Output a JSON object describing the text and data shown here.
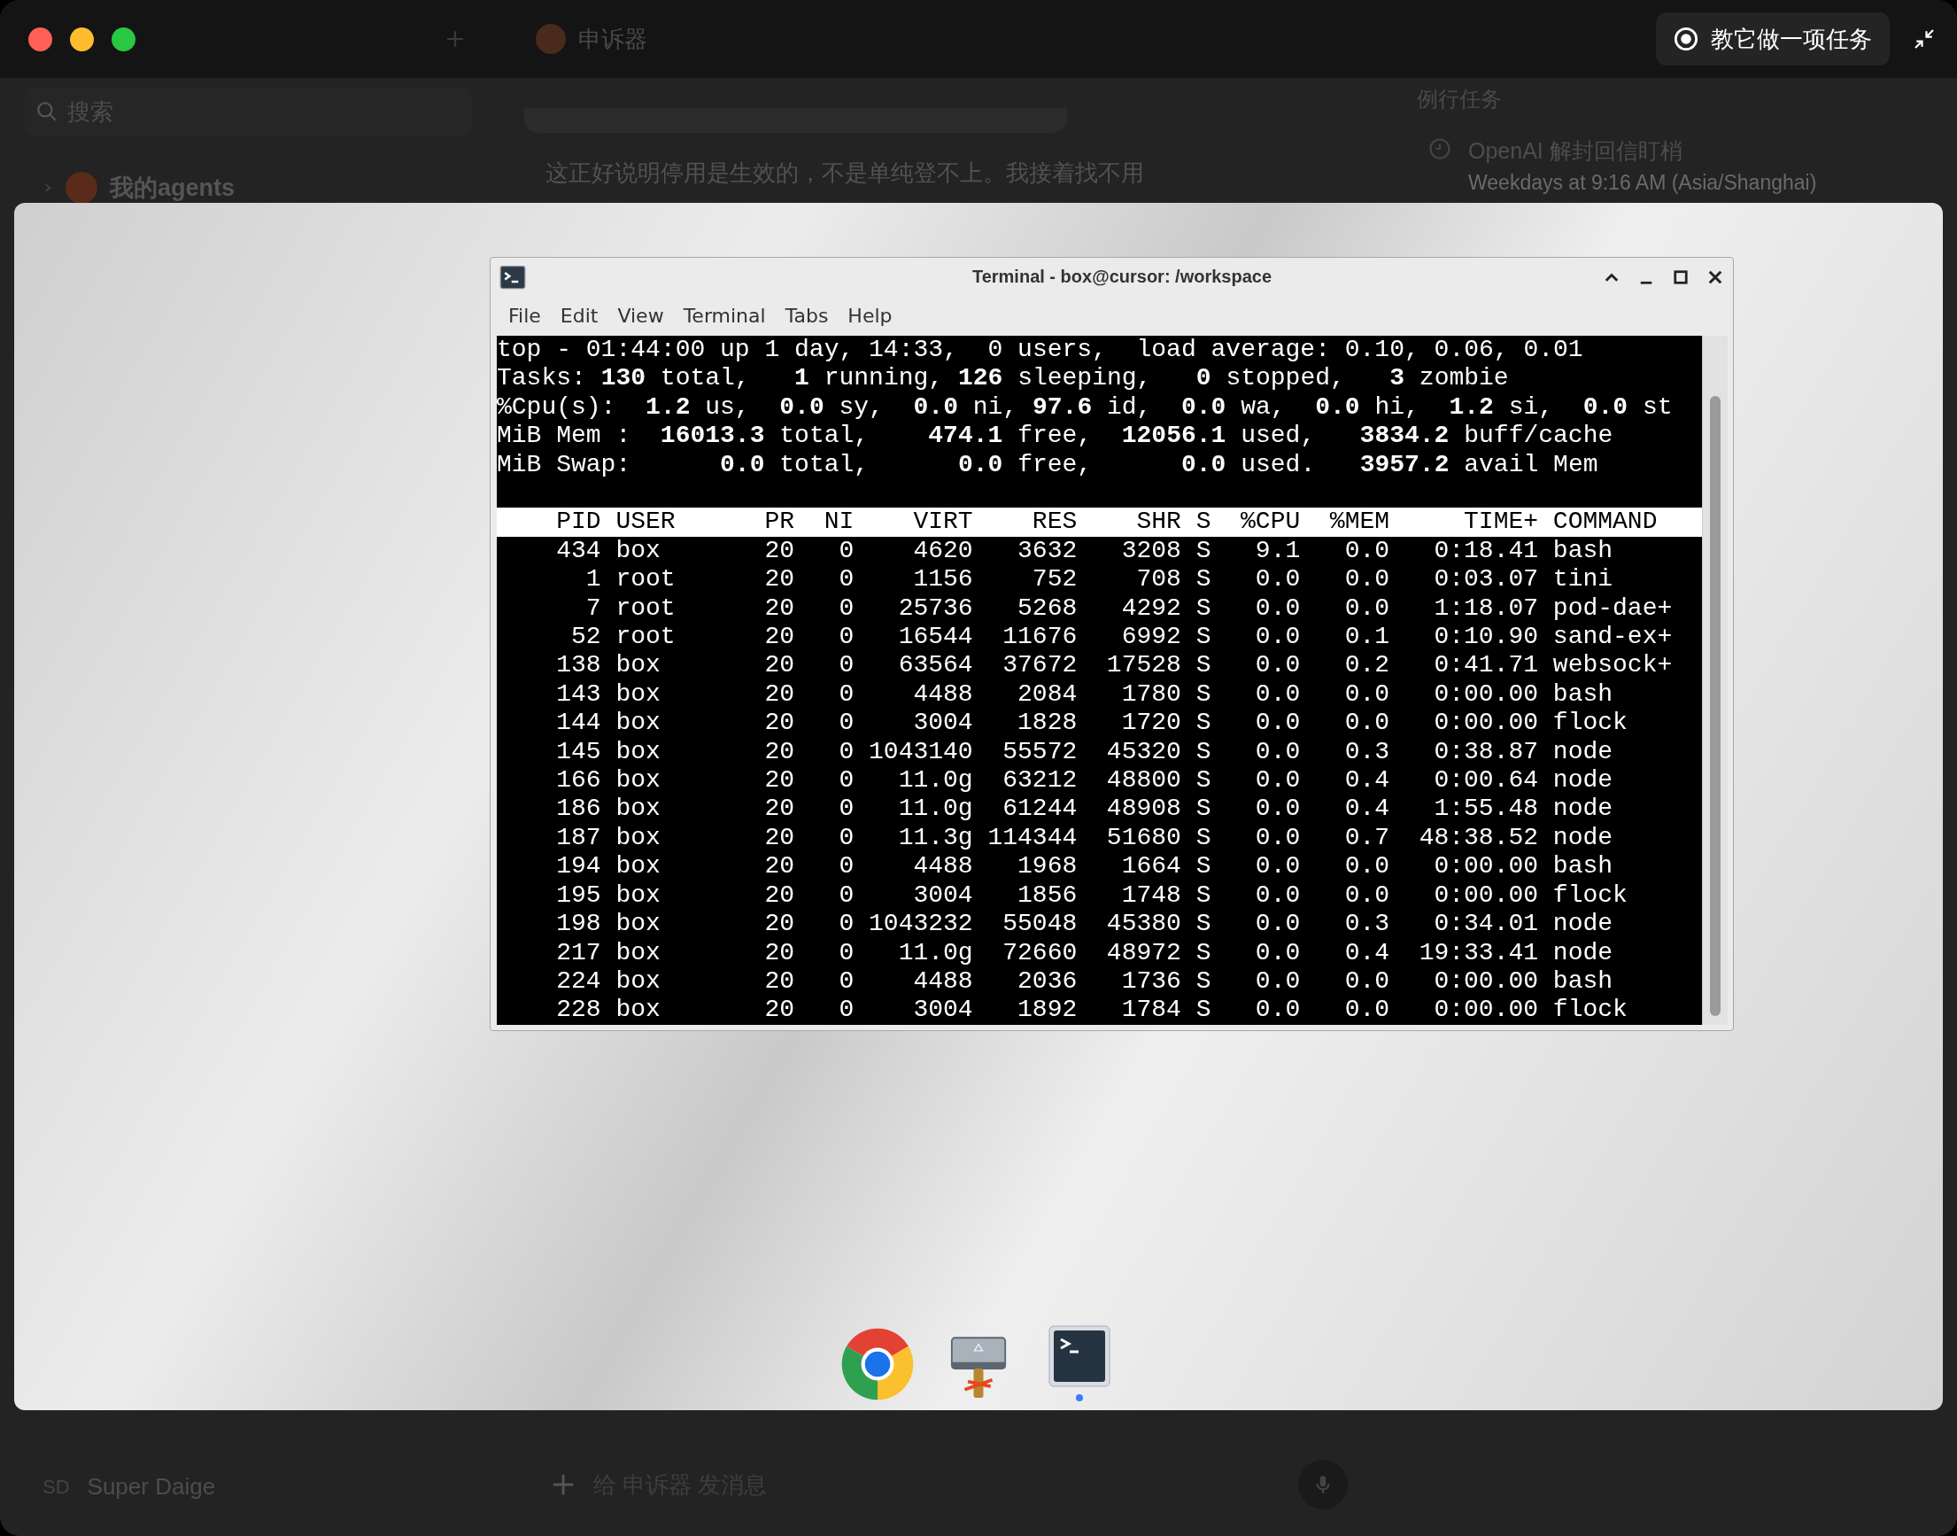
{
  "top_bar": {
    "title": "申诉器",
    "teach_button": "教它做一项任务"
  },
  "sidebar": {
    "search": {
      "placeholder": "搜索"
    },
    "items": [
      {
        "label": "我的agents"
      }
    ],
    "user": {
      "initials": "SD",
      "name": "Super Daige"
    }
  },
  "chat": {
    "message": "这正好说明停用是生效的，不是单纯登不上。我接着找不用",
    "composer": {
      "placeholder": "给 申诉器 发消息"
    }
  },
  "routines": {
    "title": "例行任务",
    "items": [
      {
        "name": "OpenAI 解封回信盯梢",
        "schedule": "Weekdays at 9:16 AM (Asia/Shanghai)"
      }
    ]
  },
  "terminal": {
    "title": "Terminal - box@cursor: /workspace",
    "menu": [
      "File",
      "Edit",
      "View",
      "Terminal",
      "Tabs",
      "Help"
    ],
    "summary": [
      "top - 01:44:00 up 1 day, 14:33,  0 users,  load average: 0.10, 0.06, 0.01",
      "Tasks: **130** total,   **1** running, **126** sleeping,   **0** stopped,   **3** zombie",
      "%Cpu(s):  **1.2** us,  **0.0** sy,  **0.0** ni, **97.6** id,  **0.0** wa,  **0.0** hi,  **1.2** si,  **0.0** st",
      "MiB Mem :  **16013.3** total,    **474.1** free,  **12056.1** used,   **3834.2** buff/cache",
      "MiB Swap:      **0.0** total,      **0.0** free,      **0.0** used.   **3957.2** avail Mem"
    ],
    "columns": [
      "PID",
      "USER",
      "PR",
      "NI",
      "VIRT",
      "RES",
      "SHR",
      "S",
      "%CPU",
      "%MEM",
      "TIME+",
      "COMMAND"
    ],
    "rows": [
      [
        "434",
        "box",
        "20",
        "0",
        "4620",
        "3632",
        "3208",
        "S",
        "9.1",
        "0.0",
        "0:18.41",
        "bash"
      ],
      [
        "1",
        "root",
        "20",
        "0",
        "1156",
        "752",
        "708",
        "S",
        "0.0",
        "0.0",
        "0:03.07",
        "tini"
      ],
      [
        "7",
        "root",
        "20",
        "0",
        "25736",
        "5268",
        "4292",
        "S",
        "0.0",
        "0.0",
        "1:18.07",
        "pod-dae+"
      ],
      [
        "52",
        "root",
        "20",
        "0",
        "16544",
        "11676",
        "6992",
        "S",
        "0.0",
        "0.1",
        "0:10.90",
        "sand-ex+"
      ],
      [
        "138",
        "box",
        "20",
        "0",
        "63564",
        "37672",
        "17528",
        "S",
        "0.0",
        "0.2",
        "0:41.71",
        "websock+"
      ],
      [
        "143",
        "box",
        "20",
        "0",
        "4488",
        "2084",
        "1780",
        "S",
        "0.0",
        "0.0",
        "0:00.00",
        "bash"
      ],
      [
        "144",
        "box",
        "20",
        "0",
        "3004",
        "1828",
        "1720",
        "S",
        "0.0",
        "0.0",
        "0:00.00",
        "flock"
      ],
      [
        "145",
        "box",
        "20",
        "0",
        "1043140",
        "55572",
        "45320",
        "S",
        "0.0",
        "0.3",
        "0:38.87",
        "node"
      ],
      [
        "166",
        "box",
        "20",
        "0",
        "11.0g",
        "63212",
        "48800",
        "S",
        "0.0",
        "0.4",
        "0:00.64",
        "node"
      ],
      [
        "186",
        "box",
        "20",
        "0",
        "11.0g",
        "61244",
        "48908",
        "S",
        "0.0",
        "0.4",
        "1:55.48",
        "node"
      ],
      [
        "187",
        "box",
        "20",
        "0",
        "11.3g",
        "114344",
        "51680",
        "S",
        "0.0",
        "0.7",
        "48:38.52",
        "node"
      ],
      [
        "194",
        "box",
        "20",
        "0",
        "4488",
        "1968",
        "1664",
        "S",
        "0.0",
        "0.0",
        "0:00.00",
        "bash"
      ],
      [
        "195",
        "box",
        "20",
        "0",
        "3004",
        "1856",
        "1748",
        "S",
        "0.0",
        "0.0",
        "0:00.00",
        "flock"
      ],
      [
        "198",
        "box",
        "20",
        "0",
        "1043232",
        "55048",
        "45380",
        "S",
        "0.0",
        "0.3",
        "0:34.01",
        "node"
      ],
      [
        "217",
        "box",
        "20",
        "0",
        "11.0g",
        "72660",
        "48972",
        "S",
        "0.0",
        "0.4",
        "19:33.41",
        "node"
      ],
      [
        "224",
        "box",
        "20",
        "0",
        "4488",
        "2036",
        "1736",
        "S",
        "0.0",
        "0.0",
        "0:00.00",
        "bash"
      ],
      [
        "228",
        "box",
        "20",
        "0",
        "3004",
        "1892",
        "1784",
        "S",
        "0.0",
        "0.0",
        "0:00.00",
        "flock"
      ]
    ]
  },
  "dock": {
    "items": [
      {
        "kind": "wheel",
        "running": false
      },
      {
        "kind": "sign",
        "running": false
      },
      {
        "kind": "terminal",
        "running": true
      }
    ]
  }
}
